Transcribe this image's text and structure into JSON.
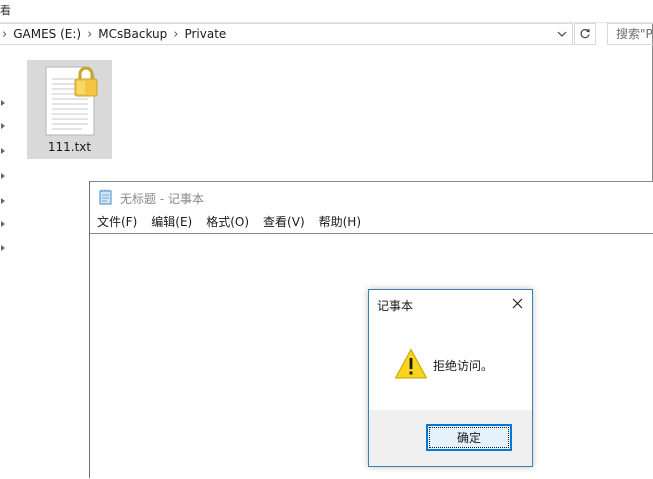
{
  "explorer": {
    "top_strip_text": "看",
    "breadcrumb": [
      "GAMES (E:)",
      "MCsBackup",
      "Private"
    ],
    "search_placeholder": "搜索\"Pr",
    "file": {
      "name": "111.txt",
      "icon": "locked-text-file-icon"
    }
  },
  "notepad": {
    "title": "无标题 - 记事本",
    "menu": [
      "文件(F)",
      "编辑(E)",
      "格式(O)",
      "查看(V)",
      "帮助(H)"
    ],
    "content": ""
  },
  "dialog": {
    "title": "记事本",
    "message": "拒绝访问。",
    "ok_label": "确定",
    "icon": "warning-icon"
  },
  "colors": {
    "dialog_border": "#3c7fb1",
    "button_focus": "#0078d7",
    "selection": "#d9d9d9",
    "warning": "#f9d31c"
  }
}
